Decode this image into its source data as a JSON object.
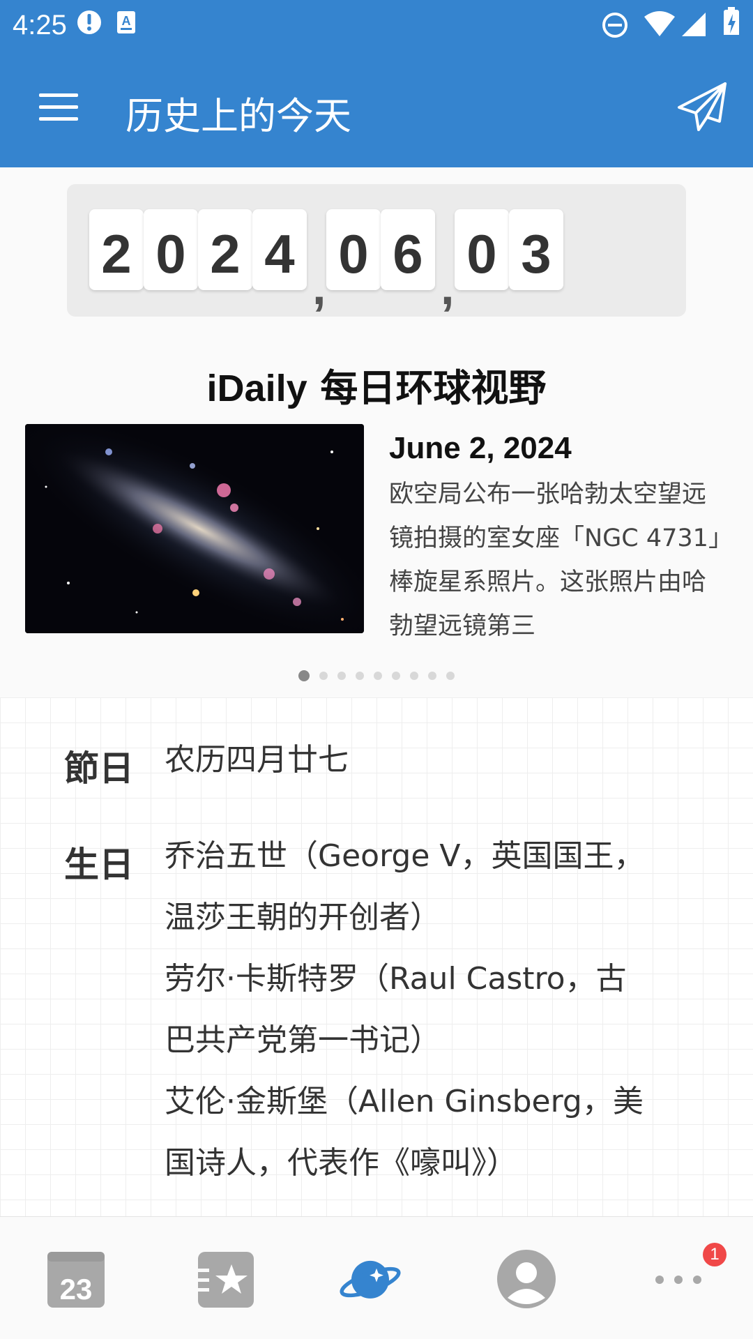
{
  "status_bar": {
    "time": "4:25",
    "icons": [
      "alert-icon",
      "keyboard-icon",
      "do-not-disturb-icon",
      "wifi-icon",
      "signal-icon",
      "battery-charging-icon"
    ]
  },
  "app_bar": {
    "title": "历史上的今天",
    "left_icon": "menu-icon",
    "right_icon": "send-icon"
  },
  "date_display": {
    "digits": [
      "2",
      "0",
      "2",
      "4",
      "0",
      "6",
      "0",
      "3"
    ],
    "separator": ","
  },
  "idaily": {
    "brand": "iDaily",
    "subtitle": " 每日环球视野",
    "date": "June 2, 2024",
    "text": "欧空局公布一张哈勃太空望远镜拍摄的室女座「NGC 4731」棒旋星系照片。这张照片由哈勃望远镜第三",
    "pages_total": 9,
    "page_active": 1
  },
  "sections": {
    "holiday": {
      "label": "節日",
      "lines": [
        "农历四月廿七"
      ]
    },
    "birthday": {
      "label": "生日",
      "lines": [
        "乔治五世（George V，英国国王，",
        "温莎王朝的开创者）",
        "劳尔·卡斯特罗（Raul Castro，古",
        "巴共产党第一书记）",
        "艾伦·金斯堡（Allen Ginsberg，美",
        "国诗人，代表作《嚎叫》）"
      ]
    }
  },
  "bottom_nav": {
    "items": [
      "calendar-icon",
      "favorites-icon",
      "planet-icon",
      "profile-icon",
      "more-icon"
    ],
    "calendar_day": "23",
    "active_index": 2,
    "badge": "1"
  },
  "colors": {
    "primary": "#3584cf",
    "badge": "#f04848"
  }
}
